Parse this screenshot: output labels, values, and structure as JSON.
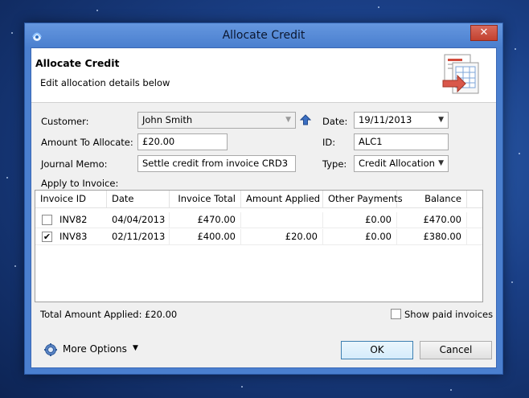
{
  "window": {
    "title": "Allocate Credit",
    "close_glyph": "✕"
  },
  "header": {
    "title": "Allocate Credit",
    "subtitle": "Edit allocation details below",
    "icon": "allocation-document-icon"
  },
  "form": {
    "customer_label": "Customer:",
    "customer_value": "John Smith",
    "amount_label": "Amount To Allocate:",
    "amount_value": "£20.00",
    "memo_label": "Journal Memo:",
    "memo_value": "Settle credit from invoice CRD3",
    "date_label": "Date:",
    "date_value": "19/11/2013",
    "id_label": "ID:",
    "id_value": "ALC1",
    "type_label": "Type:",
    "type_value": "Credit Allocation",
    "apply_label": "Apply to Invoice:"
  },
  "grid": {
    "columns": [
      "Invoice ID",
      "Date",
      "Invoice Total",
      "Amount Applied",
      "Other Payments",
      "Balance"
    ],
    "rows": [
      {
        "checked": false,
        "check_glyph": "",
        "id": "INV82",
        "date": "04/04/2013",
        "total": "£470.00",
        "applied": "",
        "other": "£0.00",
        "balance": "£470.00"
      },
      {
        "checked": true,
        "check_glyph": "✔",
        "id": "INV83",
        "date": "02/11/2013",
        "total": "£400.00",
        "applied": "£20.00",
        "other": "£0.00",
        "balance": "£380.00"
      }
    ]
  },
  "footer": {
    "total_label": "Total Amount Applied:",
    "total_value": "£20.00",
    "show_paid_label": "Show paid invoices",
    "show_paid_checked": false,
    "more_options_label": "More Options",
    "ok_label": "OK",
    "cancel_label": "Cancel"
  },
  "colors": {
    "window_frame": "#4a7fcf",
    "close_button": "#c2412f",
    "desktop": "#1a3f86"
  }
}
